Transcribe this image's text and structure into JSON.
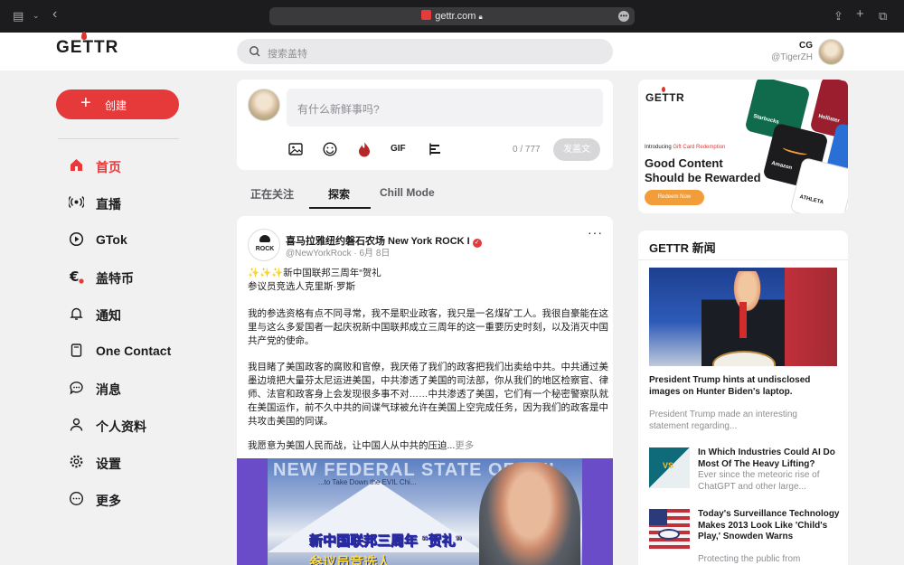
{
  "browser": {
    "url": "gettr.com"
  },
  "header": {
    "logo": "GETTR",
    "search_placeholder": "搜索盖特",
    "user": {
      "name": "CG",
      "handle": "@TigerZH"
    }
  },
  "nav": {
    "create_label": "创建",
    "items": [
      {
        "label": "首页",
        "icon": "home-icon",
        "active": true
      },
      {
        "label": "直播",
        "icon": "live-broadcast-icon"
      },
      {
        "label": "GTok",
        "icon": "play-circle-icon"
      },
      {
        "label": "盖特币",
        "icon": "euro-coin-icon"
      },
      {
        "label": "通知",
        "icon": "bell-icon"
      },
      {
        "label": "One Contact",
        "icon": "contact-book-icon"
      },
      {
        "label": "消息",
        "icon": "message-icon"
      },
      {
        "label": "个人资料",
        "icon": "person-icon"
      },
      {
        "label": "设置",
        "icon": "gear-icon"
      },
      {
        "label": "更多",
        "icon": "more-circle-icon"
      }
    ]
  },
  "composer": {
    "placeholder": "有什么新鲜事吗?",
    "counter": "0 / 777",
    "post_label": "发盖文",
    "gif_label": "GIF"
  },
  "tabs": [
    {
      "label": "正在关注"
    },
    {
      "label": "探索",
      "active": true
    },
    {
      "label": "Chill Mode"
    }
  ],
  "post": {
    "avatar_text": "ROCK",
    "author": "喜马拉雅纽约磐石农场 New York ROCK I",
    "handle": "@NewYorkRock",
    "date": "· 6月 8日",
    "menu": "···",
    "line1": "✨✨✨新中国联邦三周年“贺礼",
    "line2": "参议员竞选人克里斯·罗斯",
    "para1": "我的参选资格有点不同寻常，我不是职业政客，我只是一名煤矿工人。我很自豪能在这里与这么多爱国者一起庆祝新中国联邦成立三周年的这一重要历史时刻，以及消灭中国共产党的使命。",
    "para2": "我目睹了美国政客的腐败和官僚，我厌倦了我们的政客把我们出卖给中共。中共通过美墨边境把大量芬太尼运进美国，中共渗透了美国的司法部，你从我们的地区检察官、律师、法官和政客身上会发现很多事不对……中共渗透了美国，它们有一个秘密警察队就在美国运作，前不久中共的间谍气球被允许在美国上空完成任务，因为我们的政客是中共攻击美国的同谋。",
    "para3": "我愿意为美国人民而战，让中国人从中共的压迫...",
    "more": "更多",
    "image": {
      "banner": "NEW FEDERAL STATE OF CHI",
      "sub": "...to Take Down the EVIL Chi...",
      "caption1": "新中国联邦三周年 “贺礼”",
      "caption2": "参议员竞选人"
    }
  },
  "ad": {
    "logo": "GETTR",
    "intro_prefix": "Introducing ",
    "intro_highlight": "Gift Card Redemption",
    "headline1": "Good Content",
    "headline2": "Should be Rewarded",
    "cta": "Redeem Now",
    "cards": [
      "Starbucks",
      "Hollister",
      "Amazon",
      "ATHLETA"
    ]
  },
  "news": {
    "title": "GETTR 新闻",
    "items": [
      {
        "title": "President Trump hints at undisclosed images on Hunter Biden's laptop.",
        "summary": "President Trump made an interesting statement regarding..."
      },
      {
        "title": "In Which Industries Could AI Do Most Of The Heavy Lifting?",
        "summary": "Ever since the meteoric rise of ChatGPT and other large..."
      },
      {
        "title": "Today's Surveillance Technology Makes 2013 Look Like 'Child's Play,' Snowden Warns",
        "summary": "Protecting the public from"
      }
    ]
  }
}
